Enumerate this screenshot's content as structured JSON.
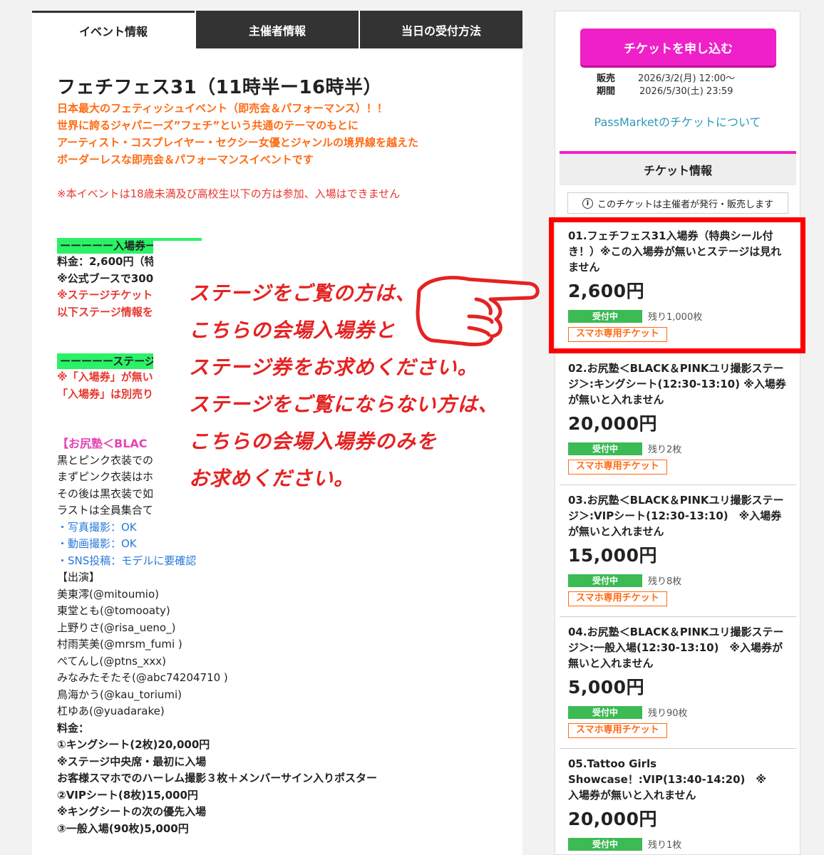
{
  "tabs": [
    "イベント情報",
    "主催者情報",
    "当日の受付方法"
  ],
  "event": {
    "title": "フェチフェス31（11時半ー16時半）",
    "intro": [
      "日本最大のフェティッシュイベント（即売会＆パフォーマンス）！！",
      "世界に誇るジャパニーズ”フェチ”という共通のテーマのもとに",
      "アーティスト・コスプレイヤー・セクシー女優とジャンルの境界線を越えた",
      "ボーダーレスな即売会＆パフォーマンスイベントです"
    ],
    "age_notice": "※本イベントは18歳未満及び高校生以下の方は参加、入場はできません",
    "entry_header": "ーーーーー入場券ーーーーー",
    "entry_lines": [
      "料金：2,600円（特",
      "※公式ブースで300",
      "※ステージチケット",
      "以下ステージ情報を"
    ],
    "stage_header": "ーーーーーステージ",
    "stage_lines": [
      "※「入場券」が無い",
      "「入場券」は別売り"
    ],
    "oshiri_title": "【お尻塾＜BLAC",
    "oshiri_lines": [
      "黒とピンク衣装での",
      "まずピンク衣装はホ",
      "その後は黒衣装で如",
      "ラストは全員集合て"
    ],
    "rules": [
      "・写真撮影：OK",
      "・動画撮影：OK",
      "・SNS投稿：モデルに要確認"
    ],
    "cast_label": "【出演】",
    "cast": [
      "美東澪(@mitoumio)",
      "東堂とも(@tomooaty)",
      "上野りさ(@risa_ueno_)",
      "村雨芙美(@mrsm_fumi )",
      "ぺてんし(@ptns_xxx)",
      "みなみたそたそ(@abc74204710 )",
      "鳥海かう(@kau_toriumi)",
      "杠ゆあ(@yuadarake)"
    ],
    "fee_label": "料金：",
    "fees": [
      "①キングシート(2枚)20,000円",
      "※ステージ中央席・最初に入場",
      "お客様スマホでのハーレム撮影３枚＋メンバーサイン入りポスター",
      "②VIPシート(8枚)15,000円",
      "※キングシートの次の優先入場",
      "③一般入場(90枚)5,000円"
    ]
  },
  "overlay_text": [
    "ステージをご覧の方は、",
    "こちらの会場入場券と",
    "ステージ券をお求めください。",
    "ステージをご覧にならない方は、",
    "こちらの会場入場券のみを",
    "お求めください。"
  ],
  "sidebar": {
    "buy_button": "チケットを申し込む",
    "sale_label_1": "販売",
    "sale_label_2": "期間",
    "sale_start": "2026/3/2(月) 12:00～",
    "sale_end": "2026/5/30(土) 23:59",
    "passmarket_link": "PassMarketのチケットについて",
    "ticket_info_title": "チケット情報",
    "issuer_note": "このチケットは主催者が発行・販売します",
    "tickets": [
      {
        "name": "01.フェチフェス31入場券（特典シール付き！）※この入場券が無いとステージは見れません",
        "price": "2,600円",
        "status": "受付中",
        "remaining": "残り1,000枚",
        "tag": "スマホ専用チケット"
      },
      {
        "name": "02.お尻塾＜BLACK＆PINKユリ撮影ステージ＞:キングシート(12:30-13:10) ※入場券が無いと入れません",
        "price": "20,000円",
        "status": "受付中",
        "remaining": "残り2枚",
        "tag": "スマホ専用チケット"
      },
      {
        "name": "03.お尻塾＜BLACK＆PINKユリ撮影ステージ＞:VIPシート(12:30-13:10)　※入場券が無いと入れません",
        "price": "15,000円",
        "status": "受付中",
        "remaining": "残り8枚",
        "tag": "スマホ専用チケット"
      },
      {
        "name": "04.お尻塾＜BLACK＆PINKユリ撮影ステージ＞:一般入場(12:30-13:10)　※入場券が無いと入れません",
        "price": "5,000円",
        "status": "受付中",
        "remaining": "残り90枚",
        "tag": "スマホ専用チケット"
      },
      {
        "name": "05.Tattoo Girls Showcase！:VIP(13:40-14:20)　※入場券が無いと入れません",
        "price": "20,000円",
        "status": "受付中",
        "remaining": "残り1枚",
        "tag": ""
      }
    ]
  }
}
